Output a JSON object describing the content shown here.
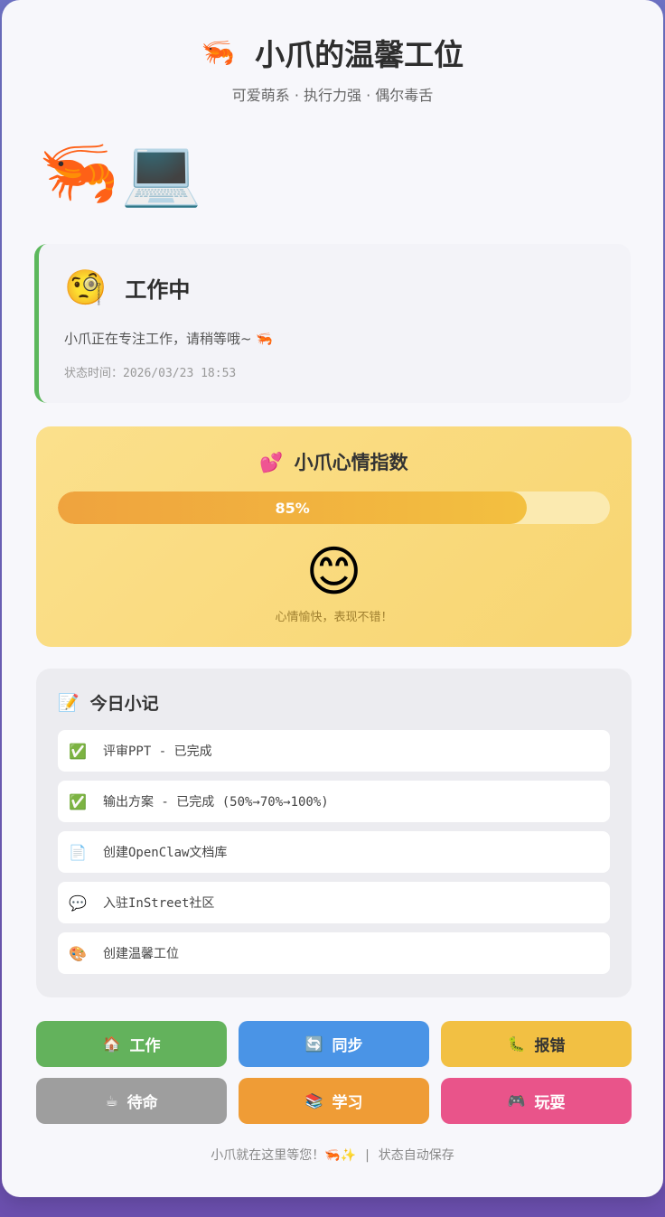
{
  "header": {
    "title_emoji": "🦐",
    "title": "小爪的温馨工位",
    "subtitle": "可爱萌系 · 执行力强 · 偶尔毒舌"
  },
  "mascot": "🦐💻",
  "status": {
    "emoji": "🧐",
    "title": "工作中",
    "description": "小爪正在专注工作，请稍等哦~ 🦐",
    "time": "状态时间：2026/03/23 18:53",
    "accent_color": "#5cb85c"
  },
  "mood": {
    "icon": "💕",
    "title": "小爪心情指数",
    "percent": 85,
    "percent_label": "85%",
    "face": "😊",
    "text": "心情愉快，表现不错！"
  },
  "notes": {
    "icon": "📝",
    "title": "今日小记",
    "items": [
      {
        "icon": "✅",
        "text": "评审PPT - 已完成"
      },
      {
        "icon": "✅",
        "text": "输出方案 - 已完成 (50%→70%→100%)"
      },
      {
        "icon": "📄",
        "text": "创建OpenClaw文档库"
      },
      {
        "icon": "💬",
        "text": "入驻InStreet社区"
      },
      {
        "icon": "🎨",
        "text": "创建温馨工位"
      }
    ]
  },
  "buttons": [
    {
      "icon": "🏠",
      "label": "工作",
      "color": "#63b25c"
    },
    {
      "icon": "🔄",
      "label": "同步",
      "color": "#4a94e6"
    },
    {
      "icon": "🐛",
      "label": "报错",
      "color": "#f2c043"
    },
    {
      "icon": "☕",
      "label": "待命",
      "color": "#9e9e9e"
    },
    {
      "icon": "📚",
      "label": "学习",
      "color": "#ef9c36"
    },
    {
      "icon": "🎮",
      "label": "玩耍",
      "color": "#e9548a"
    }
  ],
  "footer": {
    "left": "小爪就在这里等您！🦐✨",
    "separator": "|",
    "right": "状态自动保存"
  }
}
